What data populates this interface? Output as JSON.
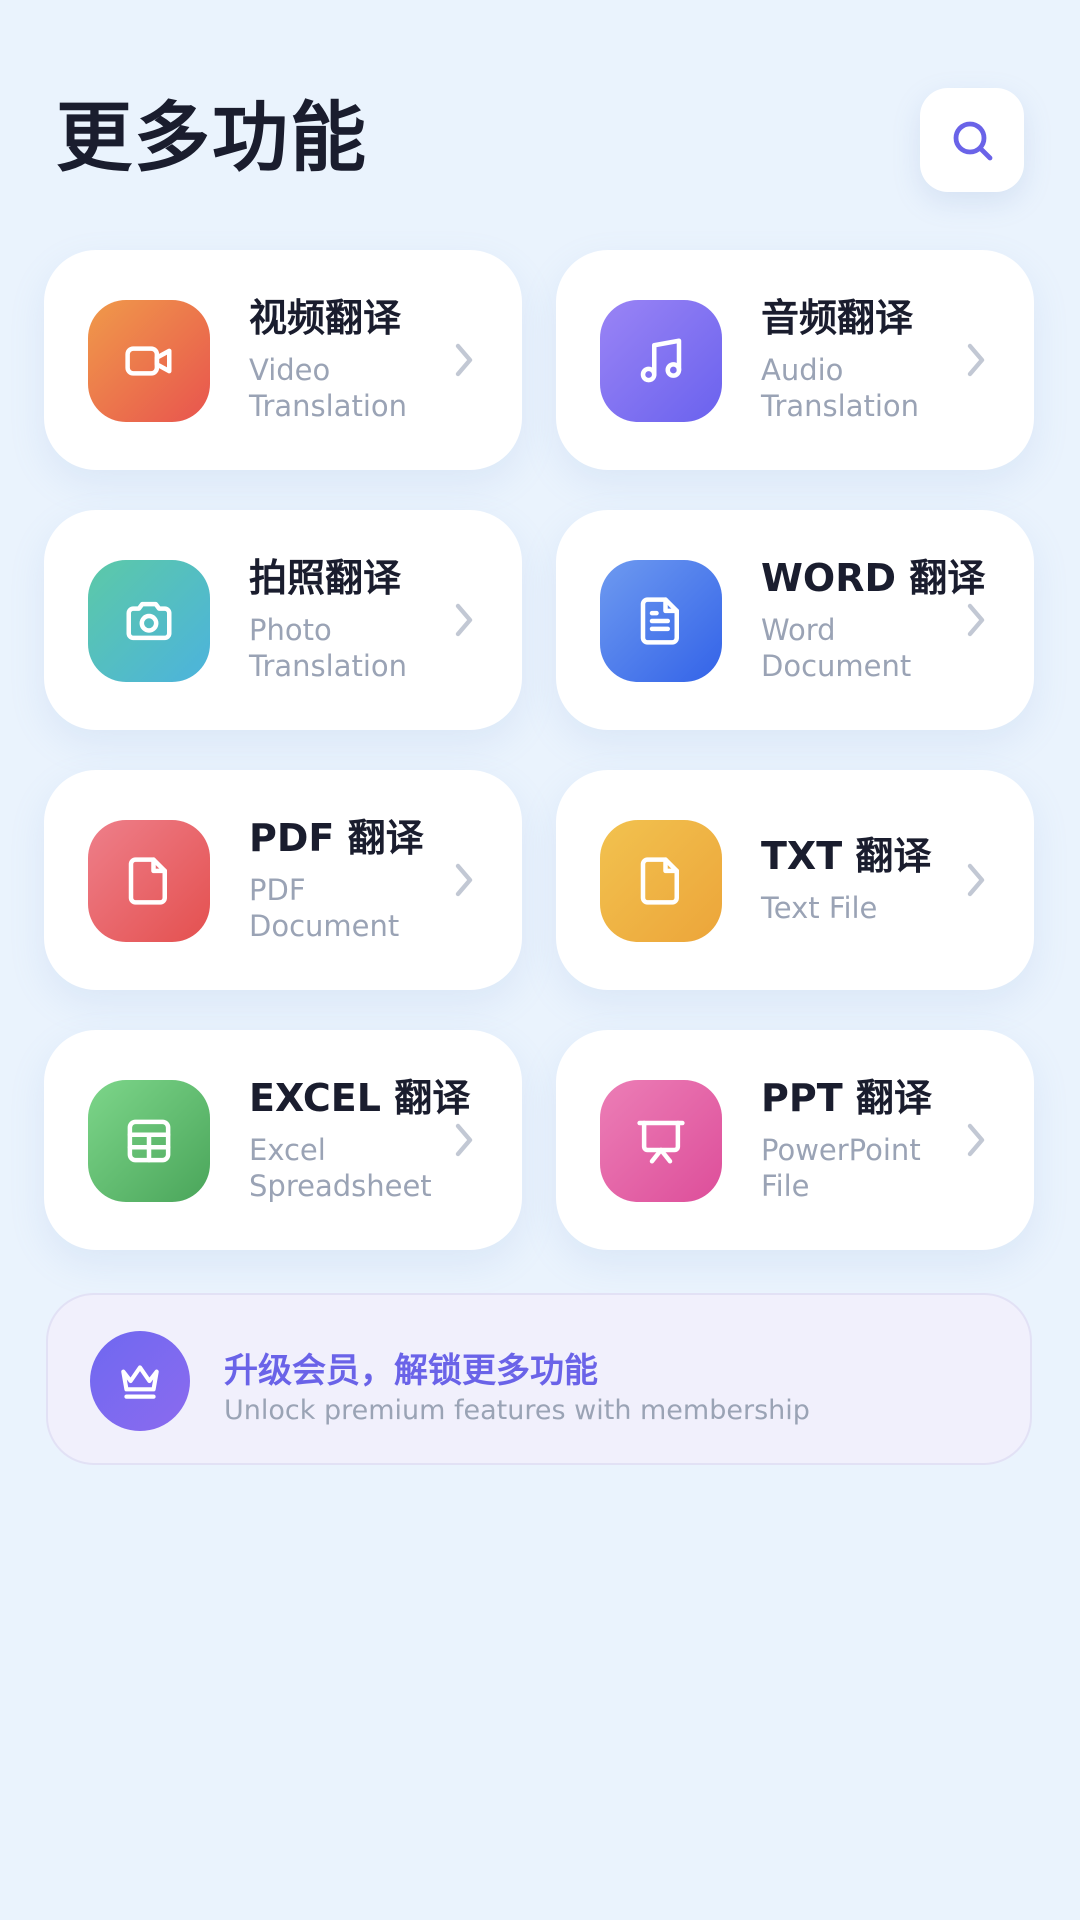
{
  "header": {
    "title": "更多功能",
    "search_icon": "search-icon"
  },
  "features": [
    {
      "title": "视频翻译",
      "subtitle": "Video Translation",
      "icon": "video-camera-icon",
      "gradient": [
        "#E8544E",
        "#F09A4A"
      ]
    },
    {
      "title": "音频翻译",
      "subtitle": "Audio Translation",
      "icon": "music-note-icon",
      "gradient": [
        "#6A62EE",
        "#9A84F5"
      ]
    },
    {
      "title": "拍照翻译",
      "subtitle": "Photo Translation",
      "icon": "camera-icon",
      "gradient": [
        "#5CC9A7",
        "#4CB3DD"
      ]
    },
    {
      "title": "WORD 翻译",
      "subtitle": "Word Document",
      "icon": "document-icon",
      "gradient": [
        "#3363E8",
        "#6E9AF0"
      ]
    },
    {
      "title": "PDF 翻译",
      "subtitle": "PDF Document",
      "icon": "file-icon",
      "gradient": [
        "#E4504F",
        "#EE7F8A"
      ]
    },
    {
      "title": "TXT 翻译",
      "subtitle": "Text File",
      "icon": "file-icon",
      "gradient": [
        "#ECA53A",
        "#F2C24F"
      ]
    },
    {
      "title": "EXCEL 翻译",
      "subtitle": "Excel Spreadsheet",
      "icon": "spreadsheet-icon",
      "gradient": [
        "#4AA55A",
        "#7DD68A"
      ]
    },
    {
      "title": "PPT 翻译",
      "subtitle": "PowerPoint File",
      "icon": "presentation-icon",
      "gradient": [
        "#DD4E9A",
        "#EC7EB6"
      ]
    }
  ],
  "promo": {
    "title": "升级会员，解锁更多功能",
    "subtitle": "Unlock premium features with membership",
    "icon": "crown-icon"
  },
  "colors": {
    "background": "#EAF3FD",
    "accent": "#6A63E8",
    "title_text": "#1A1D2E",
    "muted_text": "#9AA3B5"
  }
}
